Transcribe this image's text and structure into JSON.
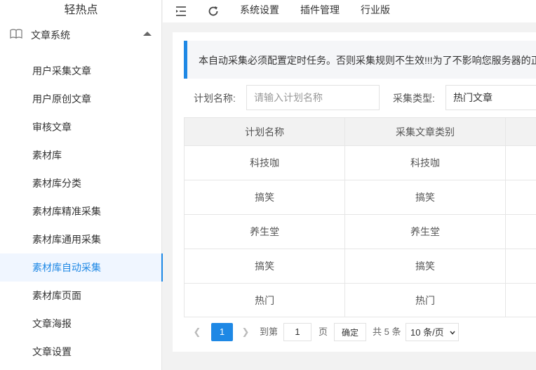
{
  "sidebar": {
    "logo": "轻热点",
    "group_label": "文章系统",
    "items": [
      {
        "label": "用户采集文章"
      },
      {
        "label": "用户原创文章"
      },
      {
        "label": "审核文章"
      },
      {
        "label": "素材库"
      },
      {
        "label": "素材库分类"
      },
      {
        "label": "素材库精准采集"
      },
      {
        "label": "素材库通用采集"
      },
      {
        "label": "素材库自动采集"
      },
      {
        "label": "素材库页面"
      },
      {
        "label": "文章海报"
      },
      {
        "label": "文章设置"
      }
    ],
    "active_item": "素材库自动采集"
  },
  "topbar": {
    "icons": [
      "menu-fold-icon",
      "refresh-icon"
    ],
    "menus": [
      {
        "label": "系统设置"
      },
      {
        "label": "插件管理"
      },
      {
        "label": "行业版"
      }
    ]
  },
  "notice": {
    "text": "本自动采集必须配置定时任务。否则采集规则不生效!!!为了不影响您服务器的正"
  },
  "filters": {
    "plan_name_label": "计划名称:",
    "plan_name_placeholder": "请输入计划名称",
    "type_label": "采集类型:",
    "type_value": "热门文章"
  },
  "table": {
    "headers": [
      "计划名称",
      "采集文章类别",
      ""
    ],
    "rows": [
      [
        "科技咖",
        "科技咖"
      ],
      [
        "搞笑",
        "搞笑"
      ],
      [
        "养生堂",
        "养生堂"
      ],
      [
        "搞笑",
        "搞笑"
      ],
      [
        "热门",
        "热门"
      ]
    ]
  },
  "pager": {
    "current": "1",
    "goto_label": "到第",
    "goto_value": "1",
    "page_unit": "页",
    "confirm": "确定",
    "total": "共 5 条",
    "page_size": "10 条/页"
  },
  "colors": {
    "accent": "#1e88e5",
    "active_bg": "#f0f6ff"
  }
}
